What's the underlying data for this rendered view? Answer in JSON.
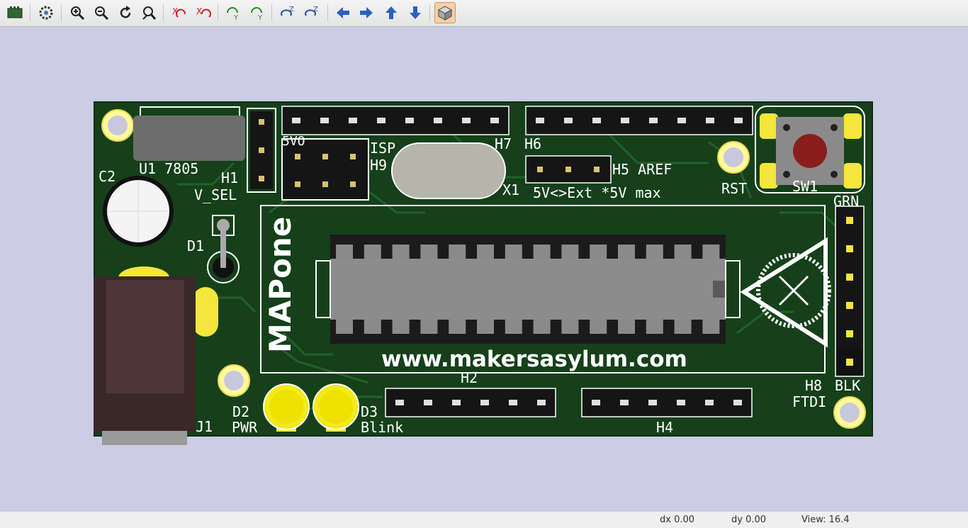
{
  "toolbar": {
    "buttons": [
      {
        "name": "render-options-icon",
        "label": ""
      },
      {
        "name": "settings-icon",
        "label": ""
      },
      {
        "name": "zoom-in-icon",
        "label": ""
      },
      {
        "name": "zoom-out-icon",
        "label": ""
      },
      {
        "name": "redraw-icon",
        "label": ""
      },
      {
        "name": "zoom-fit-icon",
        "label": ""
      },
      {
        "name": "rotate-x-cw-icon",
        "label": ""
      },
      {
        "name": "rotate-x-ccw-icon",
        "label": ""
      },
      {
        "name": "rotate-y-cw-icon",
        "label": ""
      },
      {
        "name": "rotate-y-ccw-icon",
        "label": ""
      },
      {
        "name": "rotate-z-cw-icon",
        "label": ""
      },
      {
        "name": "rotate-z-ccw-icon",
        "label": ""
      },
      {
        "name": "move-left-icon",
        "label": ""
      },
      {
        "name": "move-right-icon",
        "label": ""
      },
      {
        "name": "move-up-icon",
        "label": ""
      },
      {
        "name": "move-down-icon",
        "label": ""
      },
      {
        "name": "orthographic-toggle-icon",
        "label": ""
      }
    ],
    "accent": "#f6cfa8"
  },
  "board": {
    "color": "#15401a",
    "labels": {
      "u1": "U1 7805",
      "c2": "C2",
      "h1": "H1",
      "v_sel": "V_SEL",
      "d1": "D1",
      "d2": "D2",
      "pwr": "PWR",
      "d3": "D3",
      "blink": "Blink",
      "j1": "J1",
      "h2": "H2",
      "h4": "H4",
      "h5": "H5 AREF",
      "ext": "5V<>Ext *5V max",
      "h6": "H6",
      "h7": "H7",
      "h8": "H8",
      "ftdi": "FTDI",
      "h9": "H9",
      "isp": "ISP",
      "x1": "X1",
      "rst": "RST",
      "sw1": "SW1",
      "grn": "GRN",
      "blk": "BLK",
      "fivevo": "5VO",
      "brand": "MAPone",
      "url": "www.makersasylum.com"
    }
  },
  "status": {
    "dx": "dx 0.00",
    "dy": "dy 0.00",
    "view": "View: 16.4"
  }
}
